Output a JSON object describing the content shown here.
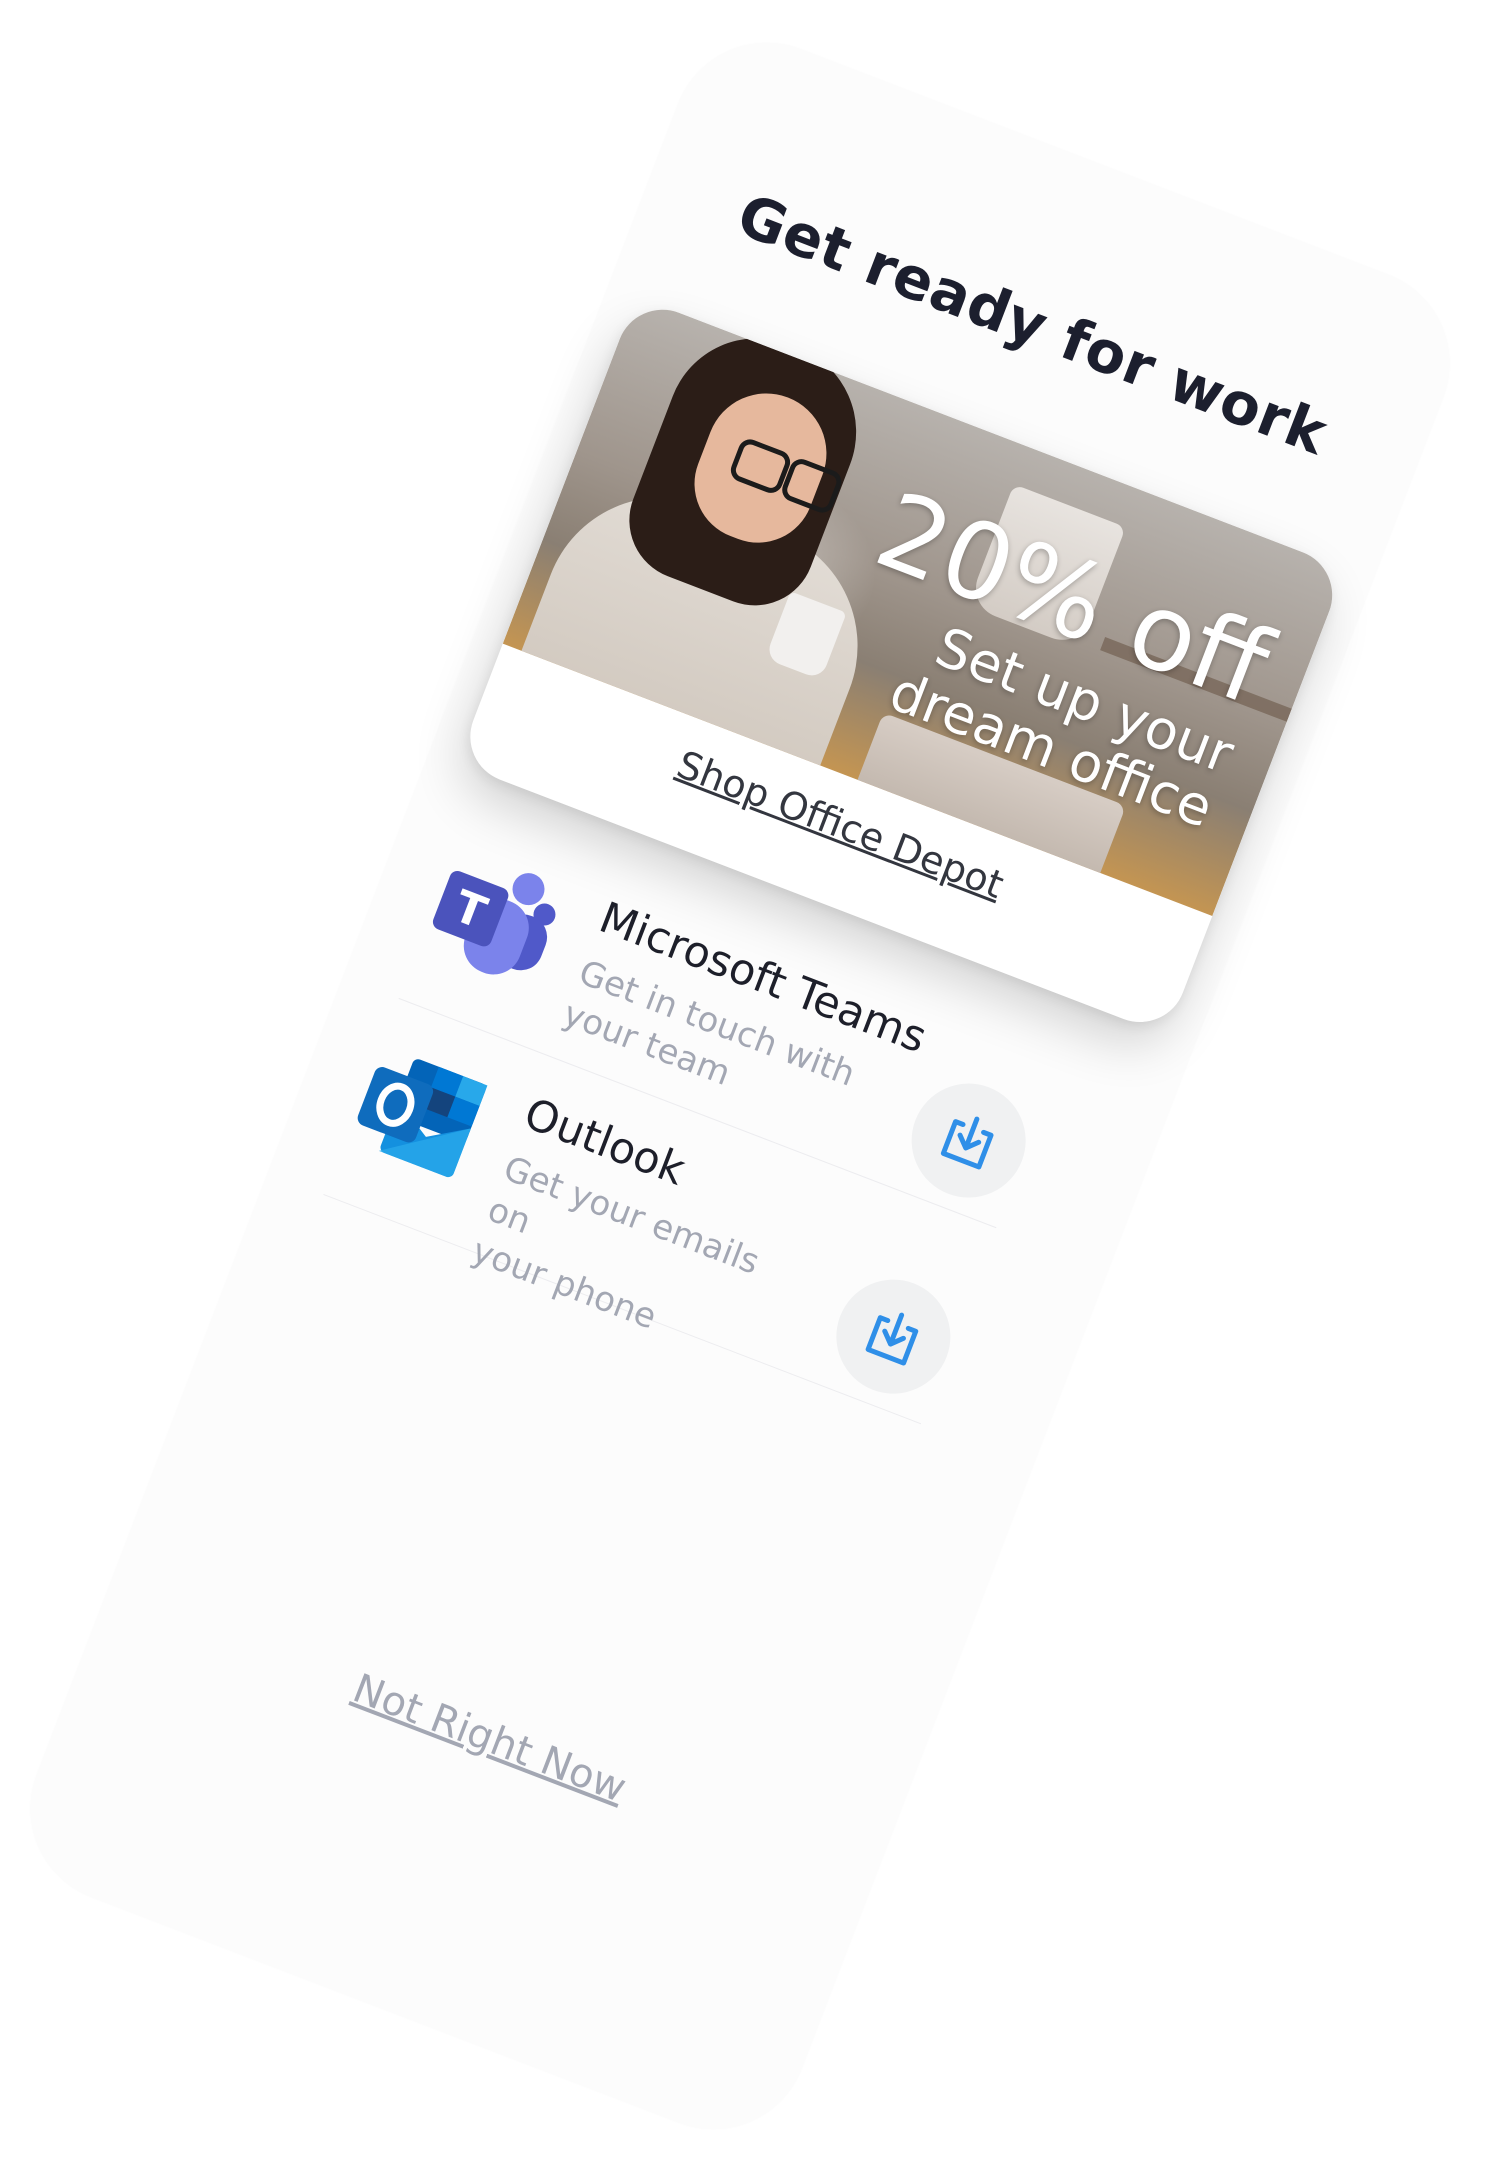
{
  "title": "Get ready for work",
  "promo": {
    "headline": "20% off",
    "subhead_line1": "Set up your",
    "subhead_line2": "dream office",
    "link": "Shop Office Depot"
  },
  "apps": [
    {
      "name": "Microsoft Teams",
      "desc_line1": "Get in touch with",
      "desc_line2": "your team",
      "icon": "teams-logo"
    },
    {
      "name": "Outlook",
      "desc_line1": "Get your emails on",
      "desc_line2": "your phone",
      "icon": "outlook-logo"
    }
  ],
  "download_icon": "download-icon",
  "skip_label": "Not Right Now",
  "colors": {
    "accent_blue": "#2f8fe8",
    "teams_purple": "#5b5fc7",
    "outlook_blue": "#0f6cbd"
  }
}
